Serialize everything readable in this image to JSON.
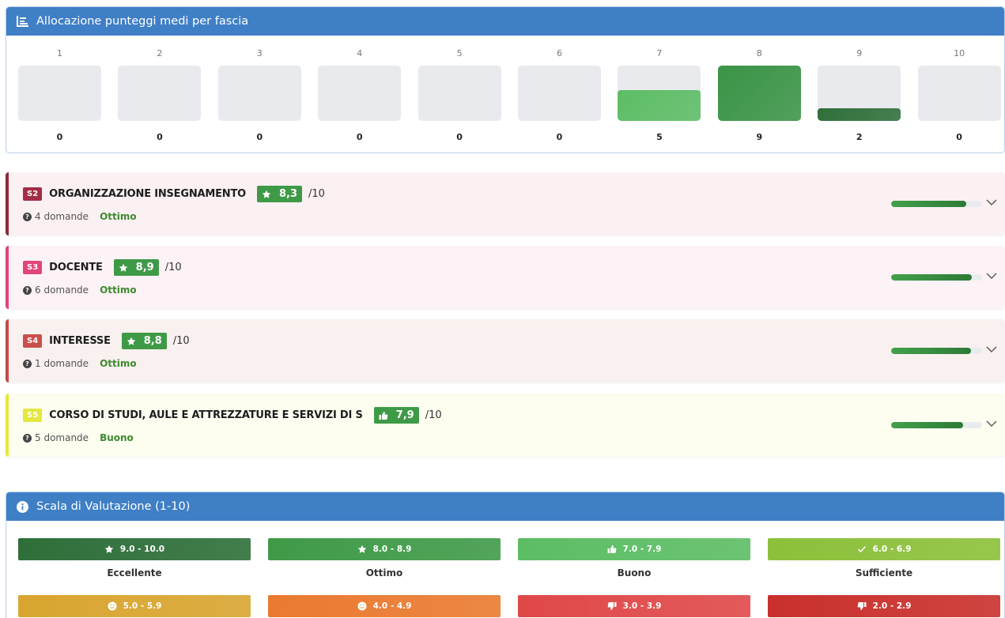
{
  "distribution": {
    "title": "Allocazione punteggi medi per fascia",
    "icon": "bar-chart-icon",
    "max_count": 9,
    "bins": [
      {
        "label": "1",
        "count": "0",
        "value": 0,
        "color": "#e9eaee"
      },
      {
        "label": "2",
        "count": "0",
        "value": 0,
        "color": "#e9eaee"
      },
      {
        "label": "3",
        "count": "0",
        "value": 0,
        "color": "#e9eaee"
      },
      {
        "label": "4",
        "count": "0",
        "value": 0,
        "color": "#e9eaee"
      },
      {
        "label": "5",
        "count": "0",
        "value": 0,
        "color": "#e9eaee"
      },
      {
        "label": "6",
        "count": "0",
        "value": 0,
        "color": "#e9eaee"
      },
      {
        "label": "7",
        "count": "5",
        "value": 5,
        "color": "#5cbd64"
      },
      {
        "label": "8",
        "count": "9",
        "value": 9,
        "color": "#3a9446"
      },
      {
        "label": "9",
        "count": "2",
        "value": 2,
        "color": "#2e6f39"
      },
      {
        "label": "10",
        "count": "0",
        "value": 0,
        "color": "#e9eaee"
      }
    ]
  },
  "sections": [
    {
      "code": "S2",
      "name": "ORGANIZZAZIONE INSEGNAMENTO",
      "score": "8,3",
      "score_icon": "star-icon",
      "max": "/10",
      "questions": "4 domande",
      "level": "Ottimo",
      "level_color": "#3d8b2f",
      "fraction": 0.83,
      "accent": "#8c2a3c",
      "code_bg": "#a32d45",
      "bg": "#fbf1f3"
    },
    {
      "code": "S3",
      "name": "DOCENTE",
      "score": "8,9",
      "score_icon": "star-icon",
      "max": "/10",
      "questions": "6 domande",
      "level": "Ottimo",
      "level_color": "#3d8b2f",
      "fraction": 0.89,
      "accent": "#e2457a",
      "code_bg": "#e2457a",
      "bg": "#fdf2f5"
    },
    {
      "code": "S4",
      "name": "INTERESSE",
      "score": "8,8",
      "score_icon": "star-icon",
      "max": "/10",
      "questions": "1 domande",
      "level": "Ottimo",
      "level_color": "#3d8b2f",
      "fraction": 0.88,
      "accent": "#c24c4c",
      "code_bg": "#c9504a",
      "bg": "#f8f1ef"
    },
    {
      "code": "S5",
      "name": "CORSO DI STUDI, AULE E ATTREZZATURE E SERVIZI DI S",
      "score": "7,9",
      "score_icon": "thumbs-up-icon",
      "max": "/10",
      "questions": "5 domande",
      "level": "Buono",
      "level_color": "#3d8b2f",
      "fraction": 0.79,
      "accent": "#e8e83a",
      "code_bg": "#e4e840",
      "bg": "#fdfdf0"
    }
  ],
  "scale": {
    "title": "Scala di Valutazione (1-10)",
    "icon": "info-icon",
    "items": [
      {
        "range": "9.0 - 10.0",
        "label": "Eccellente",
        "icon": "star-icon",
        "color": "#2e6f39"
      },
      {
        "range": "8.0 - 8.9",
        "label": "Ottimo",
        "icon": "star-icon",
        "color": "#3f9a48"
      },
      {
        "range": "7.0 - 7.9",
        "label": "Buono",
        "icon": "thumbs-up-icon",
        "color": "#5cbd64"
      },
      {
        "range": "6.0 - 6.9",
        "label": "Sufficiente",
        "icon": "check-icon",
        "color": "#8cc03a"
      },
      {
        "range": "5.0 - 5.9",
        "label": "",
        "icon": "neutral-face-icon",
        "color": "#d9a530"
      },
      {
        "range": "4.0 - 4.9",
        "label": "",
        "icon": "neutral-face-icon",
        "color": "#ea7a30"
      },
      {
        "range": "3.0 - 3.9",
        "label": "",
        "icon": "thumbs-down-icon",
        "color": "#e04848"
      },
      {
        "range": "2.0 - 2.9",
        "label": "",
        "icon": "thumbs-down-icon",
        "color": "#c9302c"
      }
    ]
  }
}
